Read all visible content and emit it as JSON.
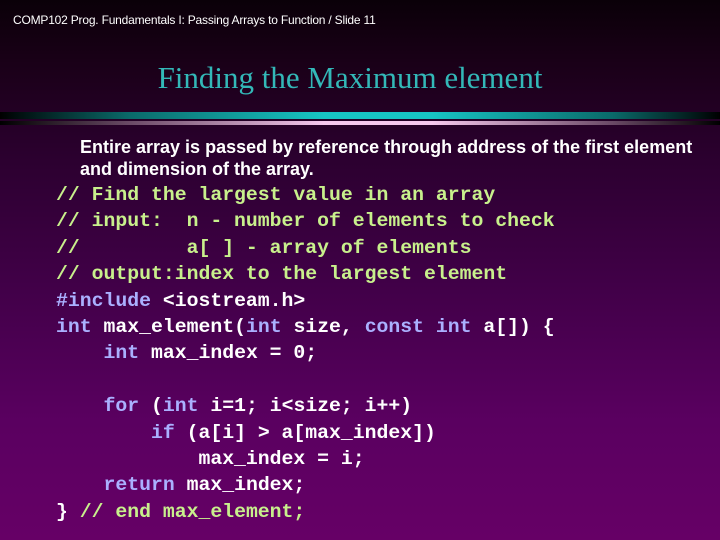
{
  "header": {
    "text": "COMP102  Prog. Fundamentals I: Passing Arrays to Function / Slide 11"
  },
  "slide": {
    "title": "Finding the Maximum element",
    "intro": "Entire array is passed by reference through address of the first element and dimension of the array.",
    "code_lines": [
      [
        {
          "t": "// Find the largest value in an array",
          "k": "comment"
        }
      ],
      [
        {
          "t": "// input:  n - number of elements to check",
          "k": "comment"
        }
      ],
      [
        {
          "t": "//         a[ ] - array of elements",
          "k": "comment"
        }
      ],
      [
        {
          "t": "// output:index to the largest element",
          "k": "comment"
        }
      ],
      [
        {
          "t": "#include",
          "k": "kw"
        },
        {
          "t": " <iostream.h>",
          "k": "text"
        }
      ],
      [
        {
          "t": "int",
          "k": "kw"
        },
        {
          "t": " max_element(",
          "k": "text"
        },
        {
          "t": "int",
          "k": "kw"
        },
        {
          "t": " size, ",
          "k": "text"
        },
        {
          "t": "const int",
          "k": "kw"
        },
        {
          "t": " a[]) {",
          "k": "text"
        }
      ],
      [
        {
          "t": "    ",
          "k": "text"
        },
        {
          "t": "int",
          "k": "kw"
        },
        {
          "t": " max_index = 0;",
          "k": "text"
        }
      ],
      [
        {
          "t": "",
          "k": "text"
        }
      ],
      [
        {
          "t": "    ",
          "k": "text"
        },
        {
          "t": "for",
          "k": "kw"
        },
        {
          "t": " (",
          "k": "text"
        },
        {
          "t": "int",
          "k": "kw"
        },
        {
          "t": " i=1; i<size; i++)",
          "k": "text"
        }
      ],
      [
        {
          "t": "        ",
          "k": "text"
        },
        {
          "t": "if",
          "k": "kw"
        },
        {
          "t": " (a[i] > a[max_index])",
          "k": "text"
        }
      ],
      [
        {
          "t": "            max_index = i;",
          "k": "text"
        }
      ],
      [
        {
          "t": "    ",
          "k": "text"
        },
        {
          "t": "return",
          "k": "kw"
        },
        {
          "t": " max_index;",
          "k": "text"
        }
      ],
      [
        {
          "t": "} ",
          "k": "text"
        },
        {
          "t": "// end max_element;",
          "k": "comment"
        }
      ]
    ]
  },
  "colors": {
    "title": "#33b8b8",
    "comment": "#c8f08c",
    "keyword": "#aab0ff",
    "text": "#ffffff",
    "background_bottom": "#660066",
    "bar_cyan": "#17c4c4",
    "bar_pink": "#f6c8ee"
  }
}
